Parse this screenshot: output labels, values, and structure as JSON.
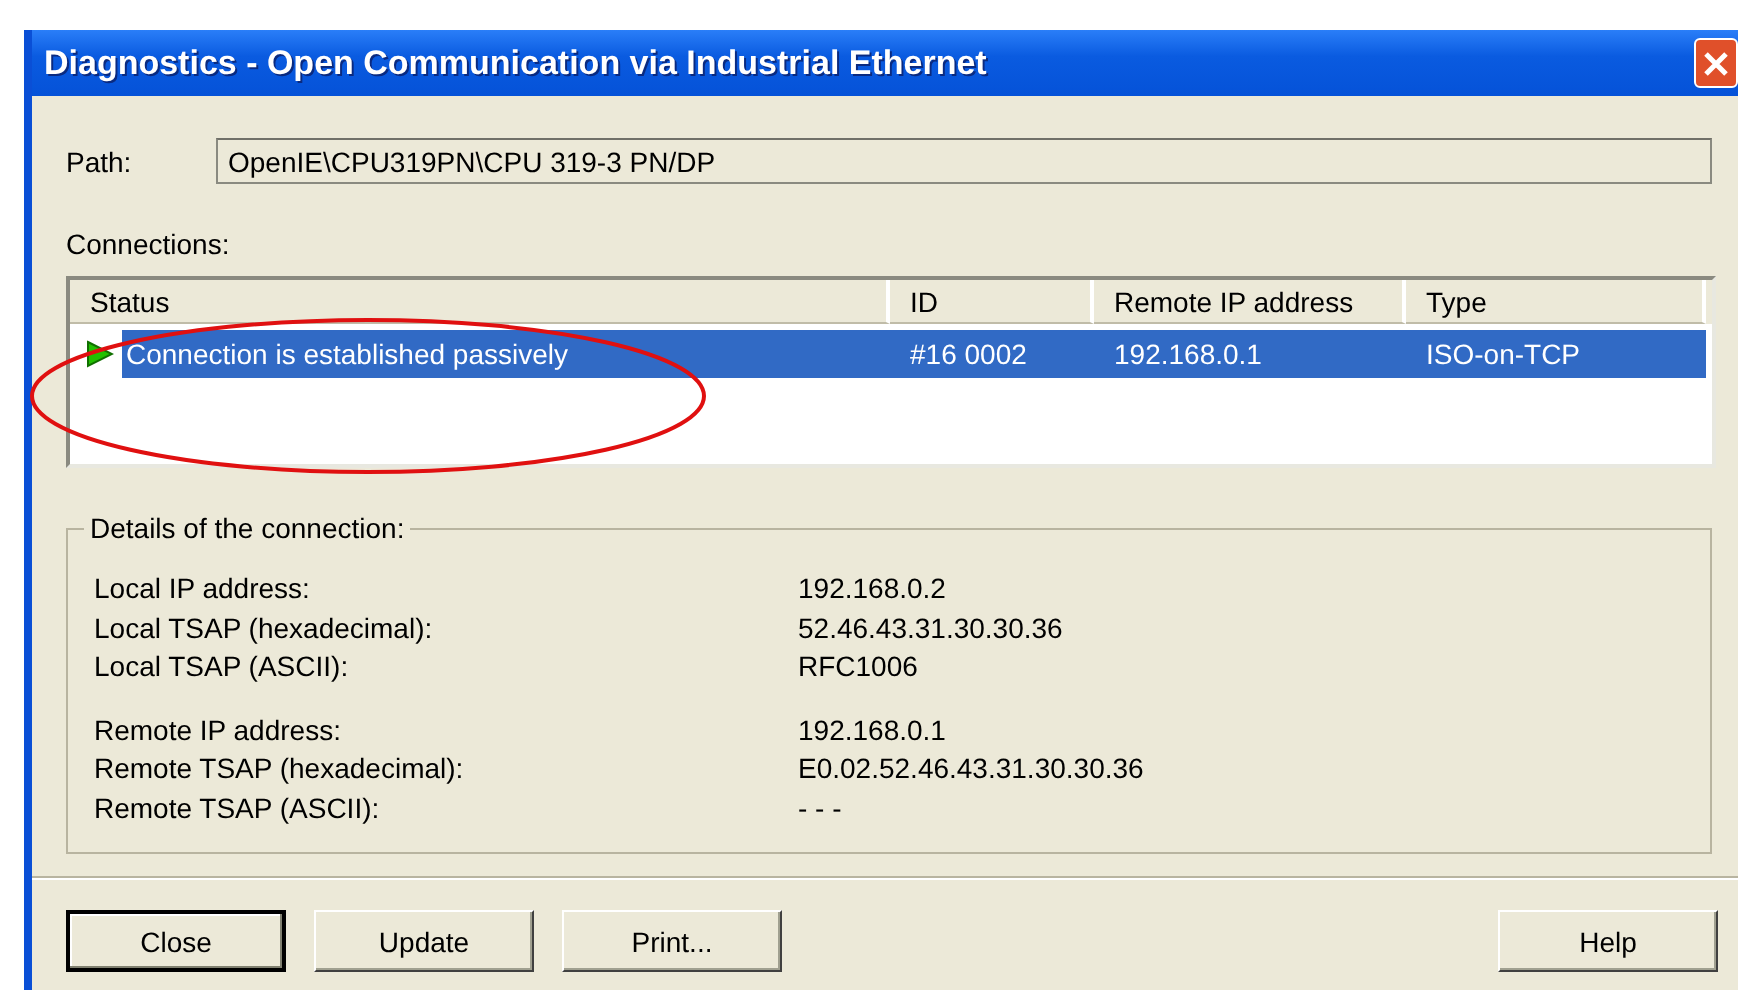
{
  "window": {
    "title": "Diagnostics - Open Communication via Industrial Ethernet"
  },
  "path": {
    "label": "Path:",
    "value": "OpenIE\\CPU319PN\\CPU 319-3 PN/DP"
  },
  "connections": {
    "label": "Connections:",
    "columns": [
      "Status",
      "ID",
      "Remote IP address",
      "Type"
    ],
    "rows": [
      {
        "status": "Connection is established passively",
        "id": "#16 0002",
        "remote_ip": "192.168.0.1",
        "type": "ISO-on-TCP",
        "selected": true
      }
    ]
  },
  "details": {
    "title": "Details of the connection:",
    "groups": [
      [
        {
          "label": "Local IP address:",
          "value": "192.168.0.2"
        },
        {
          "label": "Local TSAP (hexadecimal):",
          "value": "52.46.43.31.30.30.36"
        },
        {
          "label": "Local TSAP (ASCII):",
          "value": "RFC1006"
        }
      ],
      [
        {
          "label": "Remote IP address:",
          "value": "192.168.0.1"
        },
        {
          "label": "Remote TSAP (hexadecimal):",
          "value": "E0.02.52.46.43.31.30.30.36"
        },
        {
          "label": "Remote TSAP (ASCII):",
          "value": "- - -"
        }
      ]
    ]
  },
  "buttons": [
    {
      "label": "Close",
      "default": true
    },
    {
      "label": "Update",
      "default": false
    },
    {
      "label": "Print...",
      "default": false
    },
    {
      "label": "Help",
      "default": false
    }
  ]
}
